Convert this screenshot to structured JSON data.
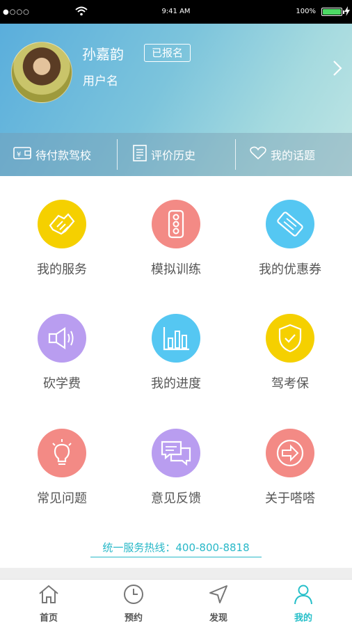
{
  "status": {
    "time": "9:41 AM",
    "battery": "100%",
    "signal": "●○○○"
  },
  "profile": {
    "name": "孙嘉韵",
    "badge": "已报名",
    "subtitle": "用户名"
  },
  "quick_actions": [
    {
      "label": "待付款驾校",
      "icon": "wallet-icon"
    },
    {
      "label": "评价历史",
      "icon": "list-icon"
    },
    {
      "label": "我的话题",
      "icon": "heart-icon"
    }
  ],
  "grid": [
    {
      "label": "我的服务",
      "icon": "handshake-icon",
      "color": "#f5d000"
    },
    {
      "label": "模拟训练",
      "icon": "traffic-light-icon",
      "color": "#f38a85"
    },
    {
      "label": "我的优惠券",
      "icon": "ticket-icon",
      "color": "#55c7f2"
    },
    {
      "label": "砍学费",
      "icon": "megaphone-icon",
      "color": "#b99df0"
    },
    {
      "label": "我的进度",
      "icon": "bar-chart-icon",
      "color": "#55c7f2"
    },
    {
      "label": "驾考保",
      "icon": "shield-check-icon",
      "color": "#f5d000"
    },
    {
      "label": "常见问题",
      "icon": "lightbulb-icon",
      "color": "#f38a85"
    },
    {
      "label": "意见反馈",
      "icon": "chat-icon",
      "color": "#b99df0"
    },
    {
      "label": "关于嗒嗒",
      "icon": "arrow-circle-icon",
      "color": "#f38a85"
    }
  ],
  "hotline": "统一服务热线：400-800-8818",
  "tabs": [
    {
      "label": "首页",
      "icon": "home-icon"
    },
    {
      "label": "预约",
      "icon": "clock-icon"
    },
    {
      "label": "发现",
      "icon": "navigation-icon"
    },
    {
      "label": "我的",
      "icon": "person-icon",
      "active": true
    }
  ],
  "colors": {
    "accent": "#26bfc9",
    "header_start": "#5aaedc",
    "header_end": "#bfe5e4"
  }
}
